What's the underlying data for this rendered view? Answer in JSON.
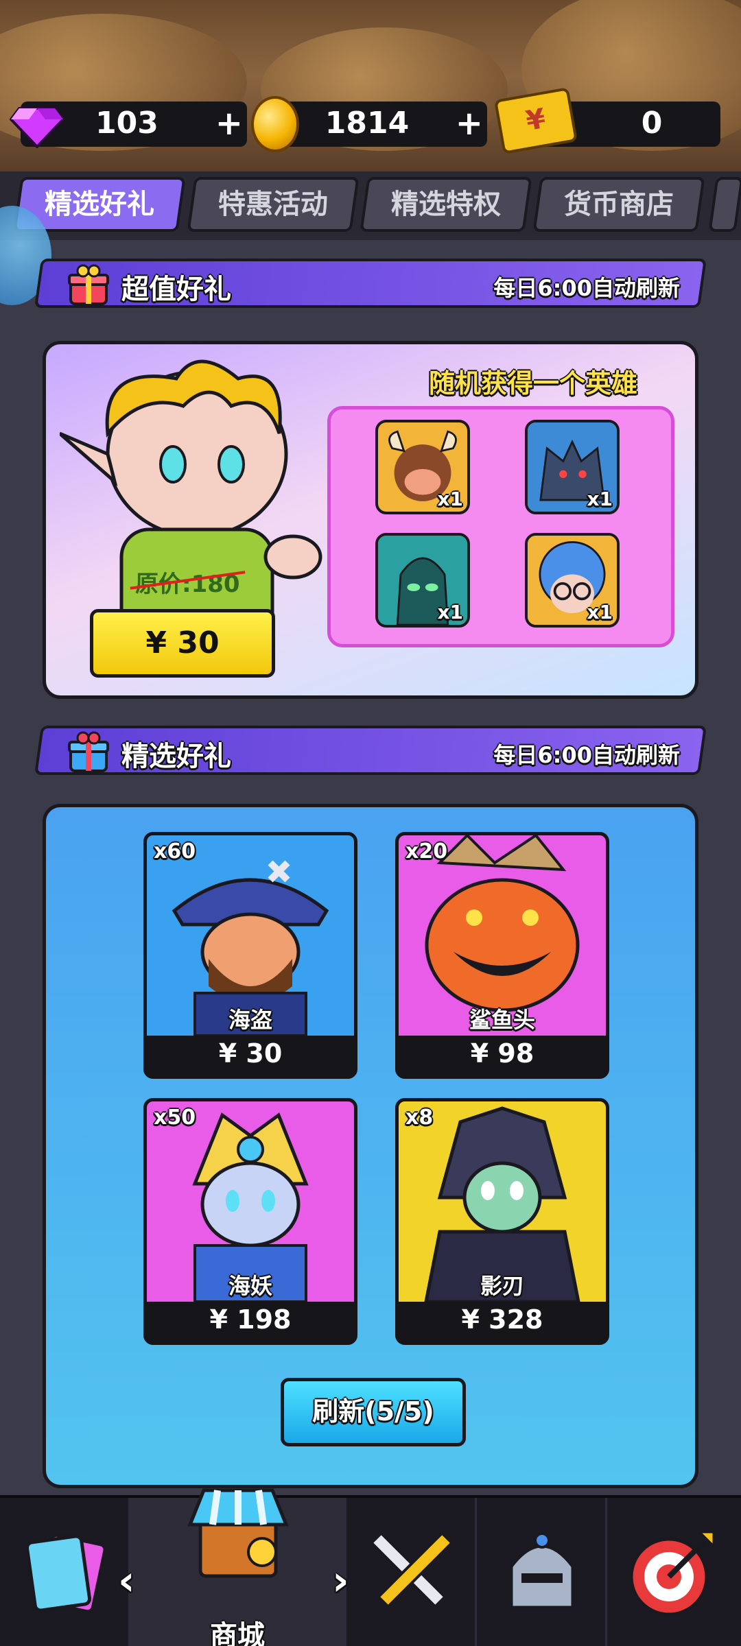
{
  "currency": {
    "gems": "103",
    "coins": "1814",
    "tickets": "0",
    "plus_label": "+",
    "ticket_symbol": "¥"
  },
  "tabs": [
    {
      "label": "精选好礼",
      "active": true
    },
    {
      "label": "特惠活动",
      "active": false
    },
    {
      "label": "精选特权",
      "active": false
    },
    {
      "label": "货币商店",
      "active": false
    }
  ],
  "section_super": {
    "title": "超值好礼",
    "note": "每日6:00自动刷新"
  },
  "promo": {
    "random_title": "随机获得一个英雄",
    "original_price": "原价:180",
    "price": "¥ 30",
    "heroes": [
      {
        "icon": "minotaur-hero-icon",
        "qty": "x1"
      },
      {
        "icon": "werewolf-hero-icon",
        "qty": "x1"
      },
      {
        "icon": "ghost-hero-icon",
        "qty": "x1"
      },
      {
        "icon": "glasses-girl-hero-icon",
        "qty": "x1"
      }
    ]
  },
  "section_selected": {
    "title": "精选好礼",
    "note": "每日6:00自动刷新"
  },
  "items": [
    {
      "count": "x60",
      "name": "海盗",
      "price": "¥ 30",
      "color": "#3aa0f0"
    },
    {
      "count": "x20",
      "name": "鲨鱼头",
      "price": "¥ 98",
      "color": "#e85ce8"
    },
    {
      "count": "x50",
      "name": "海妖",
      "price": "¥ 198",
      "color": "#e85ce8"
    },
    {
      "count": "x8",
      "name": "影刃",
      "price": "¥ 328",
      "color": "#f2d32a"
    }
  ],
  "refresh_label": "刷新(5/5)",
  "bottom_nav": {
    "shop_label": "商城",
    "prev_arrow": "‹",
    "next_arrow": "›"
  }
}
